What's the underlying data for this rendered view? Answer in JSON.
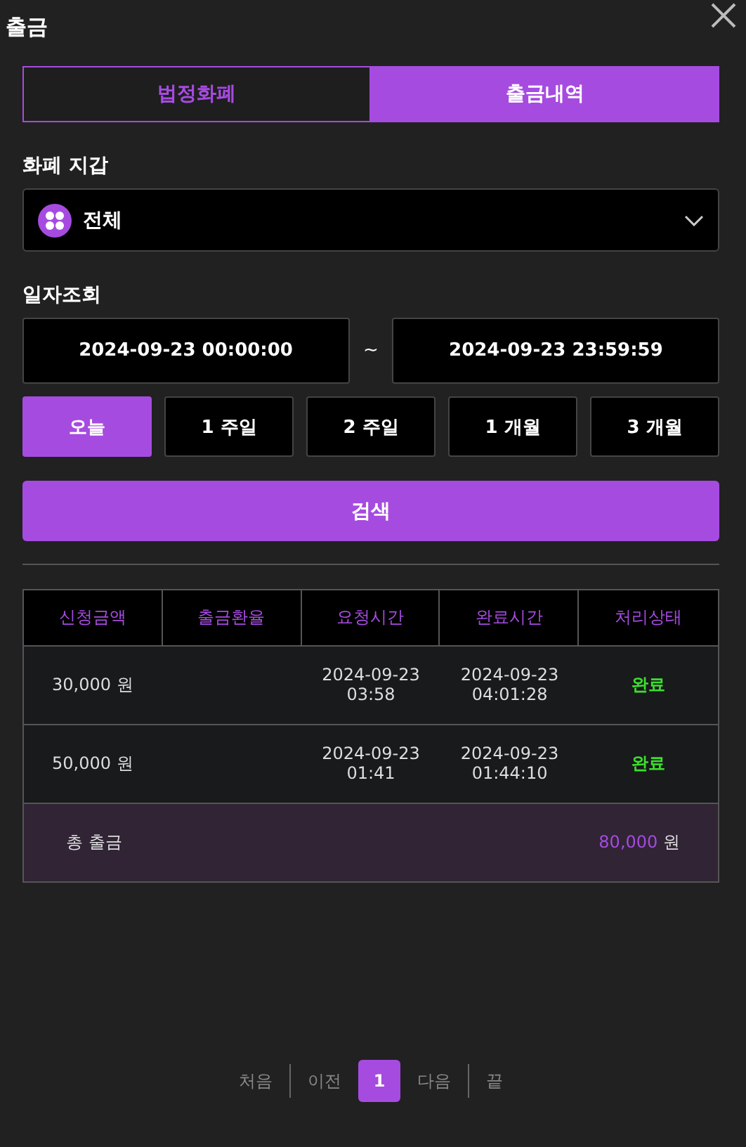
{
  "window": {
    "title": "출금"
  },
  "tabs": [
    {
      "label": "법정화폐",
      "selected": false
    },
    {
      "label": "출금내역",
      "selected": true
    }
  ],
  "wallet": {
    "label": "화폐 지갑",
    "value": "전체"
  },
  "date_range": {
    "label": "일자조회",
    "from": "2024-09-23 00:00:00",
    "separator": "~",
    "to": "2024-09-23 23:59:59"
  },
  "periods": [
    {
      "label": "오늘",
      "selected": true
    },
    {
      "label": "1 주일",
      "selected": false
    },
    {
      "label": "2 주일",
      "selected": false
    },
    {
      "label": "1 개월",
      "selected": false
    },
    {
      "label": "3 개월",
      "selected": false
    }
  ],
  "search_button": "검색",
  "table": {
    "columns": [
      "신청금액",
      "출금환율",
      "요청시간",
      "완료시간",
      "처리상태"
    ],
    "rows": [
      {
        "amount": "30,000 원",
        "requested_date": "2024-09-23",
        "requested_time": "03:58",
        "completed_date": "2024-09-23",
        "completed_time": "04:01:28",
        "status": "완료"
      },
      {
        "amount": "50,000 원",
        "requested_date": "2024-09-23",
        "requested_time": "01:41",
        "completed_date": "2024-09-23",
        "completed_time": "01:44:10",
        "status": "완료"
      }
    ],
    "total": {
      "label": "총 출금",
      "amount": "80,000",
      "unit": "원"
    }
  },
  "pagination": {
    "first": "처음",
    "prev": "이전",
    "pages": [
      {
        "label": "1",
        "selected": true
      }
    ],
    "next": "다음",
    "last": "끝"
  }
}
